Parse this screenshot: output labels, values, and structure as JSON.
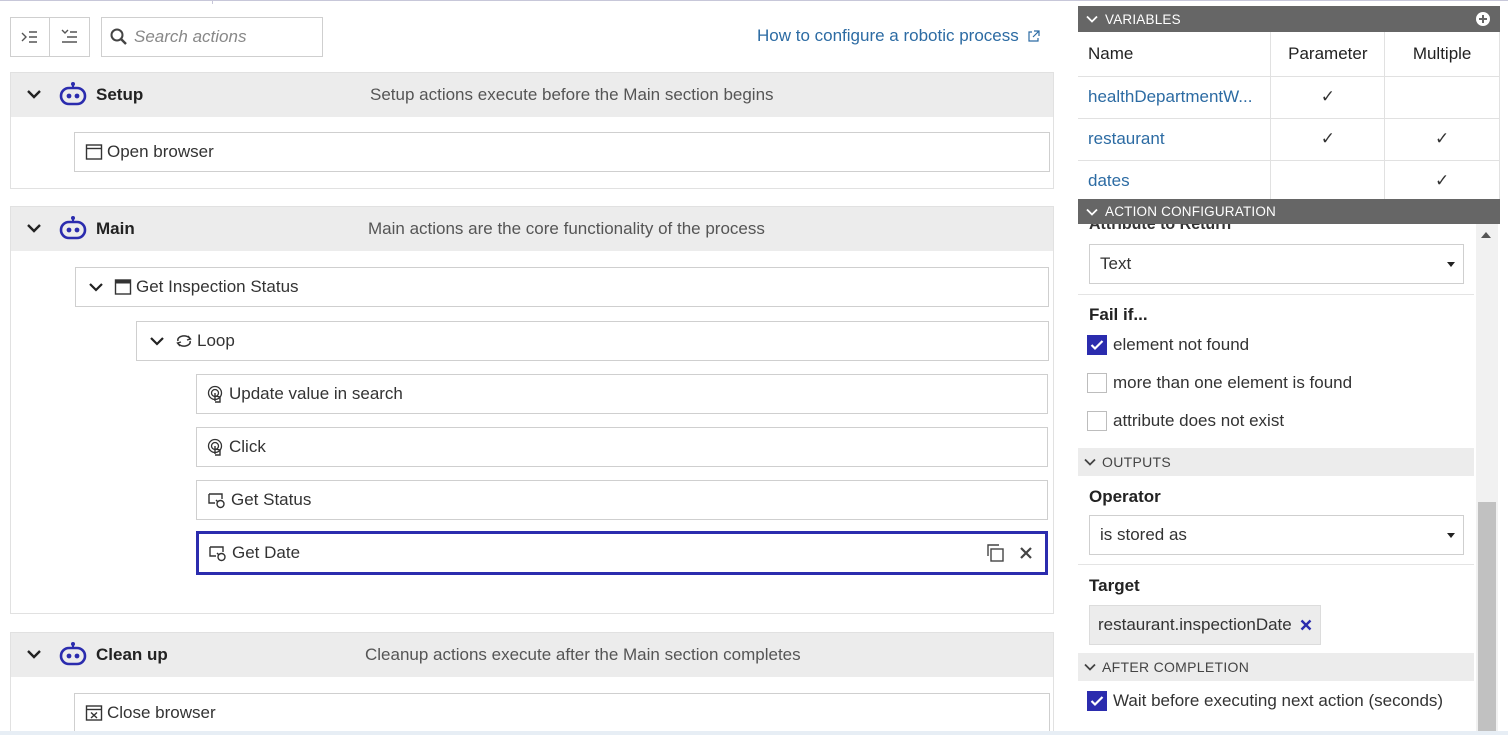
{
  "toolbar": {
    "search_placeholder": "Search actions",
    "help_link": "How to configure a robotic process"
  },
  "sections": {
    "setup": {
      "title": "Setup",
      "description": "Setup actions execute before the Main section begins",
      "actions": [
        "Open browser"
      ]
    },
    "main": {
      "title": "Main",
      "description": "Main actions are the core functionality of the process",
      "group": "Get Inspection Status",
      "loop": "Loop",
      "actions": [
        "Update value in search",
        "Click",
        "Get Status",
        "Get Date"
      ]
    },
    "cleanup": {
      "title": "Clean up",
      "description": "Cleanup actions execute after the Main section completes",
      "actions": [
        "Close browser"
      ]
    }
  },
  "variables": {
    "header": "VARIABLES",
    "columns": [
      "Name",
      "Parameter",
      "Multiple"
    ],
    "rows": [
      {
        "name": "healthDepartmentW...",
        "parameter": "✓",
        "multiple": ""
      },
      {
        "name": "restaurant",
        "parameter": "✓",
        "multiple": "✓"
      },
      {
        "name": "dates",
        "parameter": "",
        "multiple": "✓"
      }
    ]
  },
  "action_config": {
    "header": "ACTION CONFIGURATION",
    "attribute_label": "Attribute to Return",
    "attribute_value": "Text",
    "fail_if_label": "Fail if...",
    "fail_options": [
      {
        "label": "element not found",
        "checked": true
      },
      {
        "label": "more than one element is found",
        "checked": false
      },
      {
        "label": "attribute does not exist",
        "checked": false
      }
    ],
    "outputs_header": "OUTPUTS",
    "operator_label": "Operator",
    "operator_value": "is stored as",
    "target_label": "Target",
    "target_value": "restaurant.inspectionDate",
    "after_completion_header": "AFTER COMPLETION",
    "wait_label": "Wait before executing next action (seconds)",
    "wait_checked": true
  },
  "colors": {
    "accent": "#2b2cae",
    "link": "#2c6ba3",
    "panel_header": "#666666",
    "section_header": "#ececec"
  }
}
